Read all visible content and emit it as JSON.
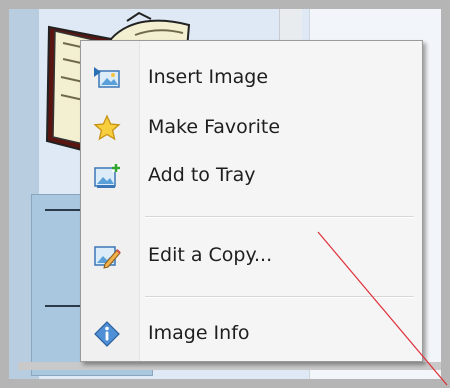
{
  "menu": {
    "items": [
      {
        "label": "Insert Image",
        "icon": "insert-image-icon"
      },
      {
        "label": "Make Favorite",
        "icon": "star-icon"
      },
      {
        "label": "Add to Tray",
        "icon": "add-to-tray-icon"
      },
      {
        "label": "Edit a Copy...",
        "icon": "edit-copy-icon"
      },
      {
        "label": "Image Info",
        "icon": "info-icon"
      }
    ]
  },
  "colors": {
    "annotation_line": "#e0303a",
    "menu_background": "#f5f5f5",
    "frame_border": "#b5b5b5"
  }
}
